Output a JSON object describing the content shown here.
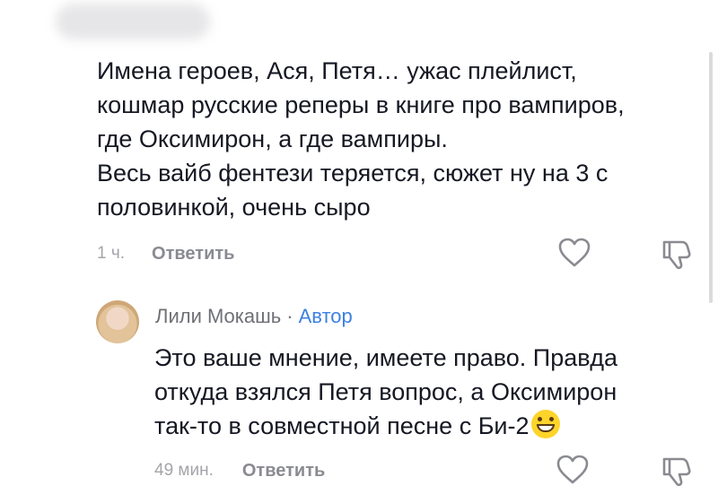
{
  "comment": {
    "text": "Имена героев, Ася, Петя… ужас плейлист,\nкошмар русские реперы в книге про вампиров,\nгде Оксимирон, а где вампиры.\nВесь вайб фентези теряется, сюжет ну на 3 с\nполовинкой, очень сыро",
    "time": "1 ч.",
    "reply_label": "Ответить",
    "like_icon": "heart-icon",
    "dislike_icon": "thumbs-down-icon"
  },
  "reply": {
    "author": "Лили Мокашь",
    "separator": "·",
    "badge": "Автор",
    "text": "Это ваше мнение, имеете право. Правда\nоткуда взялся Петя вопрос, а Оксимирон\nтак-то в совместной песне с Би-2",
    "emoji": "grinning-face-emoji",
    "time": "49 мин.",
    "reply_label": "Ответить",
    "like_icon": "heart-icon",
    "dislike_icon": "thumbs-down-icon"
  },
  "colors": {
    "text": "#161823",
    "muted": "#a4a5aa",
    "author_badge": "#3d80e0"
  }
}
